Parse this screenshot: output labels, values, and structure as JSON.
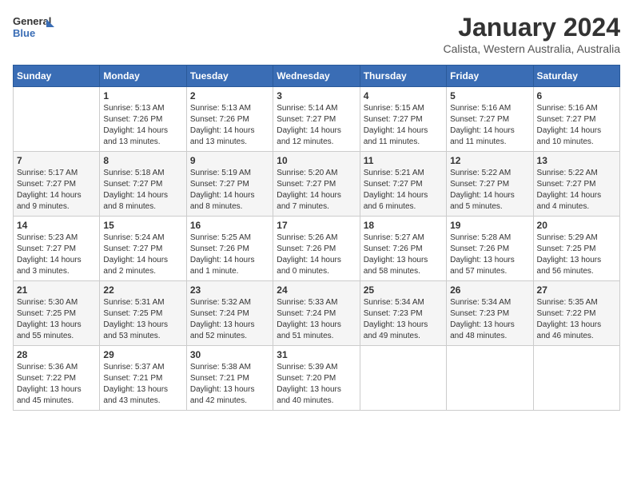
{
  "header": {
    "logo_line1": "General",
    "logo_line2": "Blue",
    "title": "January 2024",
    "subtitle": "Calista, Western Australia, Australia"
  },
  "days_of_week": [
    "Sunday",
    "Monday",
    "Tuesday",
    "Wednesday",
    "Thursday",
    "Friday",
    "Saturday"
  ],
  "weeks": [
    [
      {
        "day": "",
        "content": ""
      },
      {
        "day": "1",
        "content": "Sunrise: 5:13 AM\nSunset: 7:26 PM\nDaylight: 14 hours\nand 13 minutes."
      },
      {
        "day": "2",
        "content": "Sunrise: 5:13 AM\nSunset: 7:26 PM\nDaylight: 14 hours\nand 13 minutes."
      },
      {
        "day": "3",
        "content": "Sunrise: 5:14 AM\nSunset: 7:27 PM\nDaylight: 14 hours\nand 12 minutes."
      },
      {
        "day": "4",
        "content": "Sunrise: 5:15 AM\nSunset: 7:27 PM\nDaylight: 14 hours\nand 11 minutes."
      },
      {
        "day": "5",
        "content": "Sunrise: 5:16 AM\nSunset: 7:27 PM\nDaylight: 14 hours\nand 11 minutes."
      },
      {
        "day": "6",
        "content": "Sunrise: 5:16 AM\nSunset: 7:27 PM\nDaylight: 14 hours\nand 10 minutes."
      }
    ],
    [
      {
        "day": "7",
        "content": "Sunrise: 5:17 AM\nSunset: 7:27 PM\nDaylight: 14 hours\nand 9 minutes."
      },
      {
        "day": "8",
        "content": "Sunrise: 5:18 AM\nSunset: 7:27 PM\nDaylight: 14 hours\nand 8 minutes."
      },
      {
        "day": "9",
        "content": "Sunrise: 5:19 AM\nSunset: 7:27 PM\nDaylight: 14 hours\nand 8 minutes."
      },
      {
        "day": "10",
        "content": "Sunrise: 5:20 AM\nSunset: 7:27 PM\nDaylight: 14 hours\nand 7 minutes."
      },
      {
        "day": "11",
        "content": "Sunrise: 5:21 AM\nSunset: 7:27 PM\nDaylight: 14 hours\nand 6 minutes."
      },
      {
        "day": "12",
        "content": "Sunrise: 5:22 AM\nSunset: 7:27 PM\nDaylight: 14 hours\nand 5 minutes."
      },
      {
        "day": "13",
        "content": "Sunrise: 5:22 AM\nSunset: 7:27 PM\nDaylight: 14 hours\nand 4 minutes."
      }
    ],
    [
      {
        "day": "14",
        "content": "Sunrise: 5:23 AM\nSunset: 7:27 PM\nDaylight: 14 hours\nand 3 minutes."
      },
      {
        "day": "15",
        "content": "Sunrise: 5:24 AM\nSunset: 7:27 PM\nDaylight: 14 hours\nand 2 minutes."
      },
      {
        "day": "16",
        "content": "Sunrise: 5:25 AM\nSunset: 7:26 PM\nDaylight: 14 hours\nand 1 minute."
      },
      {
        "day": "17",
        "content": "Sunrise: 5:26 AM\nSunset: 7:26 PM\nDaylight: 14 hours\nand 0 minutes."
      },
      {
        "day": "18",
        "content": "Sunrise: 5:27 AM\nSunset: 7:26 PM\nDaylight: 13 hours\nand 58 minutes."
      },
      {
        "day": "19",
        "content": "Sunrise: 5:28 AM\nSunset: 7:26 PM\nDaylight: 13 hours\nand 57 minutes."
      },
      {
        "day": "20",
        "content": "Sunrise: 5:29 AM\nSunset: 7:25 PM\nDaylight: 13 hours\nand 56 minutes."
      }
    ],
    [
      {
        "day": "21",
        "content": "Sunrise: 5:30 AM\nSunset: 7:25 PM\nDaylight: 13 hours\nand 55 minutes."
      },
      {
        "day": "22",
        "content": "Sunrise: 5:31 AM\nSunset: 7:25 PM\nDaylight: 13 hours\nand 53 minutes."
      },
      {
        "day": "23",
        "content": "Sunrise: 5:32 AM\nSunset: 7:24 PM\nDaylight: 13 hours\nand 52 minutes."
      },
      {
        "day": "24",
        "content": "Sunrise: 5:33 AM\nSunset: 7:24 PM\nDaylight: 13 hours\nand 51 minutes."
      },
      {
        "day": "25",
        "content": "Sunrise: 5:34 AM\nSunset: 7:23 PM\nDaylight: 13 hours\nand 49 minutes."
      },
      {
        "day": "26",
        "content": "Sunrise: 5:34 AM\nSunset: 7:23 PM\nDaylight: 13 hours\nand 48 minutes."
      },
      {
        "day": "27",
        "content": "Sunrise: 5:35 AM\nSunset: 7:22 PM\nDaylight: 13 hours\nand 46 minutes."
      }
    ],
    [
      {
        "day": "28",
        "content": "Sunrise: 5:36 AM\nSunset: 7:22 PM\nDaylight: 13 hours\nand 45 minutes."
      },
      {
        "day": "29",
        "content": "Sunrise: 5:37 AM\nSunset: 7:21 PM\nDaylight: 13 hours\nand 43 minutes."
      },
      {
        "day": "30",
        "content": "Sunrise: 5:38 AM\nSunset: 7:21 PM\nDaylight: 13 hours\nand 42 minutes."
      },
      {
        "day": "31",
        "content": "Sunrise: 5:39 AM\nSunset: 7:20 PM\nDaylight: 13 hours\nand 40 minutes."
      },
      {
        "day": "",
        "content": ""
      },
      {
        "day": "",
        "content": ""
      },
      {
        "day": "",
        "content": ""
      }
    ]
  ]
}
